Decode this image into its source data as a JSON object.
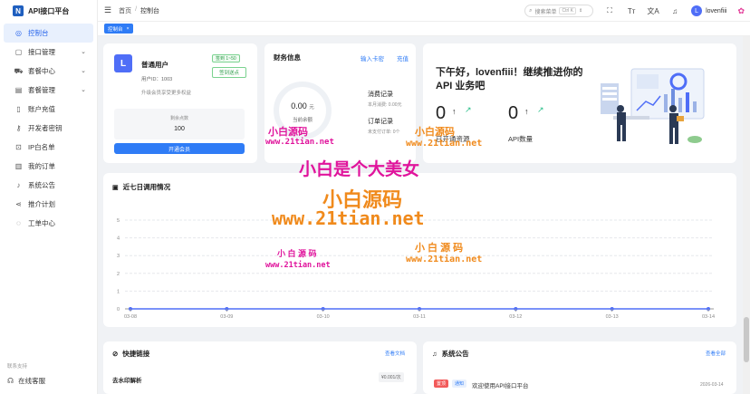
{
  "app": {
    "title": "API接口平台",
    "logo_letter": "N"
  },
  "sidebar": {
    "items": [
      {
        "label": "控制台",
        "icon": "dashboard-icon",
        "glyph": "◎",
        "active": true,
        "chevron": false
      },
      {
        "label": "接口管理",
        "icon": "api-icon",
        "glyph": "▢",
        "active": false,
        "chevron": true
      },
      {
        "label": "套餐中心",
        "icon": "cart-icon",
        "glyph": "⛟",
        "active": false,
        "chevron": true
      },
      {
        "label": "套餐管理",
        "icon": "package-icon",
        "glyph": "▤",
        "active": false,
        "chevron": true
      },
      {
        "label": "账户充值",
        "icon": "wallet-icon",
        "glyph": "▯",
        "active": false,
        "chevron": false
      },
      {
        "label": "开发者密钥",
        "icon": "key-icon",
        "glyph": "⚷",
        "active": false,
        "chevron": false
      },
      {
        "label": "IP白名单",
        "icon": "lock-icon",
        "glyph": "⊡",
        "active": false,
        "chevron": false
      },
      {
        "label": "我的订单",
        "icon": "order-icon",
        "glyph": "▥",
        "active": false,
        "chevron": false
      },
      {
        "label": "系统公告",
        "icon": "bell-icon",
        "glyph": "♪",
        "active": false,
        "chevron": false
      },
      {
        "label": "推介计划",
        "icon": "share-icon",
        "glyph": "⋖",
        "active": false,
        "chevron": false
      },
      {
        "label": "工单中心",
        "icon": "ticket-icon",
        "glyph": "◌",
        "active": false,
        "chevron": false
      }
    ],
    "footer_label": "联系支持",
    "footer_item": "在线客服"
  },
  "header": {
    "breadcrumb_home": "首页",
    "breadcrumb_sep": "/",
    "breadcrumb_current": "控制台",
    "search_placeholder": "搜索菜单",
    "search_kbd": "Ctrl K",
    "username": "lovenfiii",
    "avatar_letter": "L"
  },
  "tabs": {
    "active_label": "控制台",
    "close": "×"
  },
  "user_card": {
    "avatar_letter": "L",
    "role": "普通用户",
    "user_id": "用户ID：1003",
    "tip": "升级会员享受更多权益",
    "sign_badge": "签到 1~50",
    "sign_button": "签到送点",
    "points_label": "剩余点数",
    "points_value": "100",
    "vip_button": "开通会员"
  },
  "finance": {
    "title": "财务信息",
    "link_redeem": "输入卡密",
    "link_recharge": "充值",
    "amount": "0.00",
    "amount_unit": "元",
    "balance_label": "当前余额",
    "consume_title": "消费记录",
    "consume_sub": "本月消费: 0.00元",
    "order_title": "订单记录",
    "order_sub": "未支付订单: 0个"
  },
  "welcome": {
    "greeting": "下午好，lovenfiii！继续推进你的 API 业务吧",
    "stat1_value": "0",
    "stat1_label": "已开通资源",
    "stat2_value": "0",
    "stat2_label": "API数量"
  },
  "chart_data": {
    "type": "line",
    "title": "近七日调用情况",
    "categories": [
      "03-08",
      "03-09",
      "03-10",
      "03-11",
      "03-12",
      "03-13",
      "03-14"
    ],
    "values": [
      0,
      0,
      0,
      0,
      0,
      0,
      0
    ],
    "y_ticks": [
      0,
      1,
      2,
      3,
      4,
      5
    ],
    "ylim": [
      0,
      5
    ],
    "line_color": "#4f6ef7",
    "grid": true
  },
  "quick_links": {
    "title": "快捷链接",
    "link": "查看文档",
    "item_name": "去水印解析",
    "item_price": "¥0.001/次"
  },
  "announcements": {
    "title": "系统公告",
    "link": "查看全部",
    "badge_top": "置顶",
    "badge_notice": "通知",
    "text": "欢迎使用API接口平台",
    "date": "2026-03-14"
  },
  "watermarks": {
    "a": "小白源码",
    "b": "www.21tian.net",
    "c": "小白是个大美女",
    "d": "小白源码",
    "e": "www.21tian.net",
    "f": "小 白 源 码",
    "g": "www.21tian.net",
    "h": "小白源码",
    "i": "www.21tian.net",
    "j": "小 白 源 码",
    "k": "www.21tian.net"
  },
  "colors": {
    "primary": "#2f7cf6",
    "success": "#2d9d4a",
    "danger": "#f25a5a",
    "watermark_pink": "#e0149c",
    "watermark_orange": "#f08a1c"
  }
}
